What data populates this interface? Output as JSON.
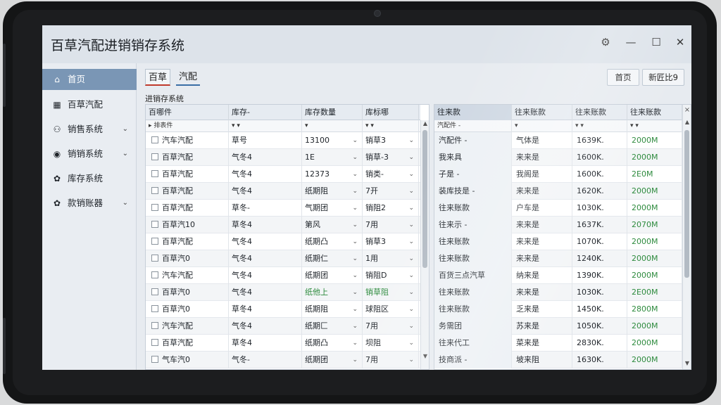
{
  "app": {
    "title": "百草汽配进销销存系统",
    "window_controls": [
      "⚙",
      "—",
      "☐",
      "✕"
    ]
  },
  "sidebar": {
    "items": [
      {
        "label": "首页",
        "icon": "home-icon",
        "glyph": "⌂",
        "active": true,
        "has_chevron": false
      },
      {
        "label": "百草汽配",
        "icon": "grid-icon",
        "glyph": "▦",
        "active": false,
        "has_chevron": false
      },
      {
        "label": "销售系统",
        "icon": "users-icon",
        "glyph": "⚇",
        "active": false,
        "has_chevron": true
      },
      {
        "label": "销销系统",
        "icon": "arrow-circle-icon",
        "glyph": "◉",
        "active": false,
        "has_chevron": true
      },
      {
        "label": "库存系统",
        "icon": "gear-icon",
        "glyph": "✿",
        "active": false,
        "has_chevron": false
      },
      {
        "label": "款销账器",
        "icon": "settings-icon",
        "glyph": "✿",
        "active": false,
        "has_chevron": true
      }
    ]
  },
  "tabs": [
    "百草",
    "汽配"
  ],
  "toolbar": {
    "home_label": "首页",
    "new_label": "新匠比9"
  },
  "subtitle": "进销存系统",
  "left_grid": {
    "headers": [
      "百哪件",
      "库存-",
      "库存数量",
      "库标哪"
    ],
    "filters": [
      "▸  排表件",
      "▾    ▾",
      "▾",
      "▾    ▾"
    ],
    "filter_dd": [
      "",
      "▾",
      "▾",
      "▾"
    ],
    "rows": [
      [
        "汽车汽配",
        "草号",
        "13100",
        "销草3"
      ],
      [
        "百草汽配",
        "气冬4",
        "1E",
        "销草-3"
      ],
      [
        "百草汽配",
        "气冬4",
        "12373",
        "销类-"
      ],
      [
        "百草汽配",
        "气冬4",
        "纸期阻",
        "7开"
      ],
      [
        "百草汽配",
        "草冬-",
        "气期团",
        "销阻2"
      ],
      [
        "百草汽10",
        "草冬4",
        "第风",
        "7用"
      ],
      [
        "百草汽配",
        "气冬4",
        "纸期凸",
        "销草3"
      ],
      [
        "百草汽0",
        "气冬4",
        "纸期仁",
        "1用"
      ],
      [
        "汽车汽配",
        "气冬4",
        "纸期团",
        "销阻D"
      ],
      [
        "百草汽0",
        "气冬4",
        "纸他上",
        "销草阻"
      ],
      [
        "百草汽0",
        "草冬4",
        "纸期阻",
        "球阻区"
      ],
      [
        "汽车汽配",
        "气冬4",
        "纸期匚",
        "7用"
      ],
      [
        "百草汽配",
        "草冬4",
        "纸期凸",
        "坝阻"
      ],
      [
        "气车汽0",
        "气冬-",
        "纸期团",
        "7用"
      ],
      [
        "百草汽配",
        "气冬4",
        "纸期凸",
        "7用"
      ]
    ],
    "green_row": 9
  },
  "right_grid": {
    "headers": [
      "往来款",
      "往来账款",
      "往来账款",
      "往来账款"
    ],
    "filters": [
      "汽配件 -",
      "▾",
      "▾    ▾",
      "▾    ▾"
    ],
    "rows": [
      [
        "汽配件 -",
        "气体是",
        "1639K.",
        "2000M"
      ],
      [
        "我来具",
        "来来是",
        "1600K.",
        "2000M"
      ],
      [
        "子是 -",
        "我阁是",
        "1600K.",
        "2E0M"
      ],
      [
        "装库技是 -",
        "来来是",
        "1620K.",
        "2000M"
      ],
      [
        "往来账款",
        "户车是",
        "1030K.",
        "2000M"
      ],
      [
        "往来示 -",
        "来来是",
        "1637K.",
        "2070M"
      ],
      [
        "往来账款",
        "来来是",
        "1070K.",
        "2000M"
      ],
      [
        "往来账款",
        "来来是",
        "1240K.",
        "2000M"
      ],
      [
        "百货三点汽草",
        "纳来是",
        "1390K.",
        "2000M"
      ],
      [
        "往来账款",
        "来来是",
        "1030K.",
        "2E00M"
      ],
      [
        "往来账款",
        "乏来是",
        "1450K.",
        "2800M"
      ],
      [
        "务需团",
        "苏来是",
        "1050K.",
        "2000M"
      ],
      [
        "往来代工",
        "菜来是",
        "2830K.",
        "2000M"
      ],
      [
        "技商派 -",
        "坡来阻",
        "1630K.",
        "2000M"
      ]
    ]
  },
  "colors": {
    "accent": "#7a96b5",
    "green": "#2e8b3e"
  }
}
